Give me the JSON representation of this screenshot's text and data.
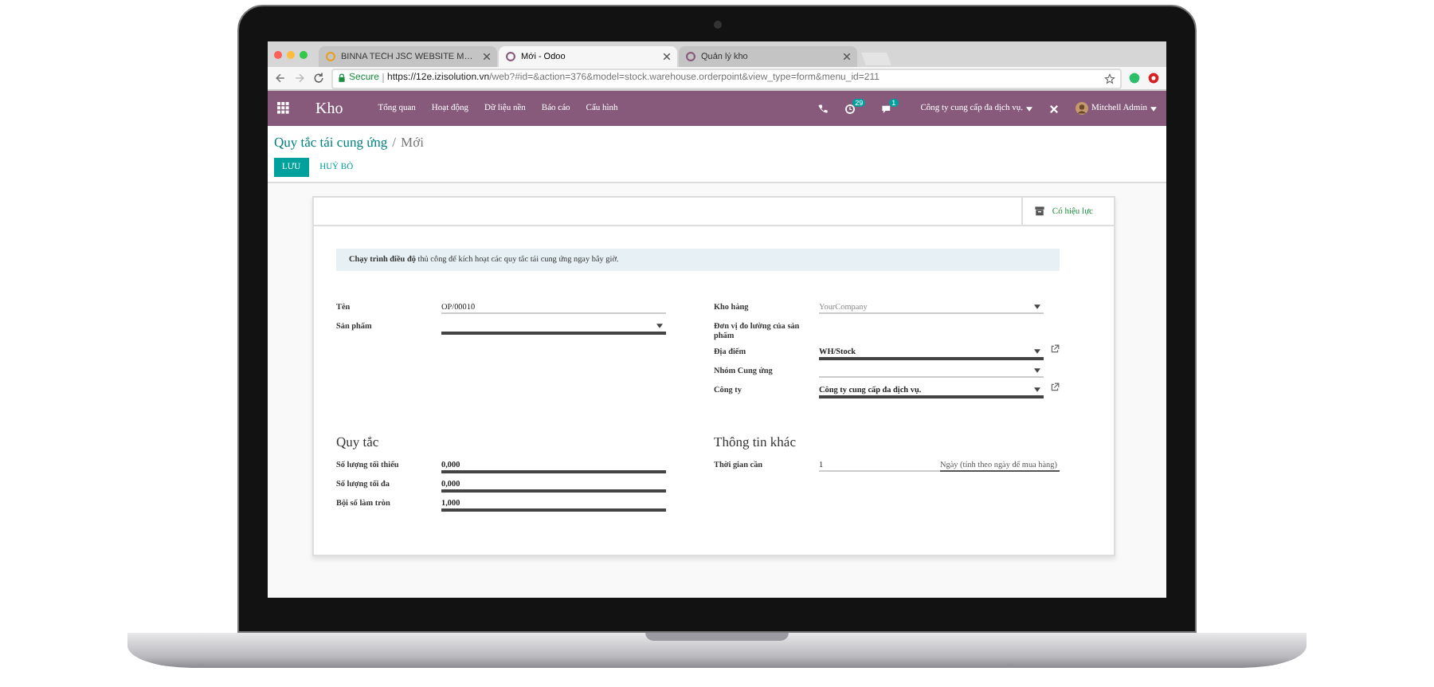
{
  "browser": {
    "tabs": [
      {
        "title": "BINNA TECH JSC WEBSITE M…",
        "selected": false
      },
      {
        "title": "Mới - Odoo",
        "selected": true
      },
      {
        "title": "Quản lý kho",
        "selected": false
      }
    ],
    "secure": "Secure",
    "url_host": "https://12e.izisolution.vn",
    "url_rest": "/web?#id=&action=376&model=stock.warehouse.orderpoint&view_type=form&menu_id=211"
  },
  "navbar": {
    "app": "Kho",
    "menu": [
      "Tổng quan",
      "Hoạt động",
      "Dữ liệu nền",
      "Báo cáo",
      "Cấu hình"
    ],
    "activity_badge": "29",
    "message_badge": "1",
    "company": "Công ty cung cấp đa dịch vụ.",
    "user": "Mitchell Admin"
  },
  "breadcrumb": {
    "parent": "Quy tắc tái cung ứng",
    "separator": "/",
    "current": "Mới"
  },
  "buttons": {
    "save": "LƯU",
    "discard": "HUỶ BỎ"
  },
  "status_button": "Có hiệu lực",
  "alert": "**Chạy trình điều độ** thủ công để kích hoạt các quy tắc tái cung ứng ngay bây giờ.",
  "left_fields": [
    {
      "label": "Tên",
      "kind": "text",
      "value": "OP/00010",
      "required": false
    },
    {
      "label": "Sản phẩm",
      "kind": "select",
      "required": true
    }
  ],
  "right_fields": [
    {
      "label": "Kho hàng",
      "kind": "select",
      "placeholder": "YourCompany",
      "required": false
    },
    {
      "label": "Đơn vị đo lường của sản phẩm",
      "kind": "readonly"
    },
    {
      "label": "Địa điểm",
      "kind": "select",
      "value": "WH/Stock",
      "required": true,
      "link": true
    },
    {
      "label": "Nhóm Cung ứng",
      "kind": "select",
      "required": false
    },
    {
      "label": "Công ty",
      "kind": "select",
      "value": "Công ty cung cấp đa dịch vụ.",
      "required": true,
      "link": true
    }
  ],
  "rules": {
    "title": "Quy tắc",
    "fields": [
      {
        "label": "Số lượng tối thiểu",
        "value": "0,000"
      },
      {
        "label": "Số lượng tối đa",
        "value": "0,000"
      },
      {
        "label": "Bội số làm tròn",
        "value": "1,000"
      }
    ]
  },
  "other": {
    "title": "Thông tin khác",
    "fields": [
      {
        "label": "Thời gian cần",
        "value": "1",
        "unit": "Ngày (tính theo ngày để mua hàng)"
      }
    ]
  }
}
